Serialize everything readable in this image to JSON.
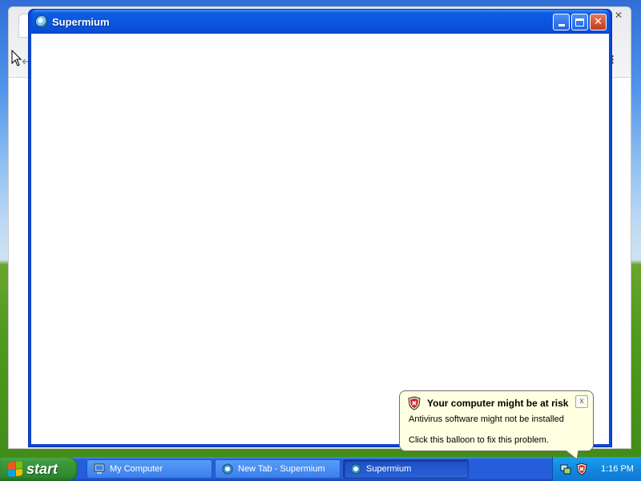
{
  "window": {
    "title": "Supermium",
    "icon": "supermium-icon"
  },
  "taskbar": {
    "start_label": "start",
    "tasks": [
      {
        "label": "My Computer",
        "icon": "my-computer-icon",
        "active": false
      },
      {
        "label": "New Tab - Supermium",
        "icon": "supermium-icon",
        "active": false
      },
      {
        "label": "Supermium",
        "icon": "supermium-icon",
        "active": true
      }
    ],
    "clock": "1:16 PM"
  },
  "balloon": {
    "title": "Your computer might be at risk",
    "line1": "Antivirus software might not be installed",
    "line2": "Click this balloon to fix this problem.",
    "icon": "security-shield-icon",
    "close_glyph": "x"
  },
  "colors": {
    "titlebar": "#0b56df",
    "taskbar": "#245edb",
    "start_button": "#3c9a3c",
    "balloon_bg": "#ffffe1"
  }
}
